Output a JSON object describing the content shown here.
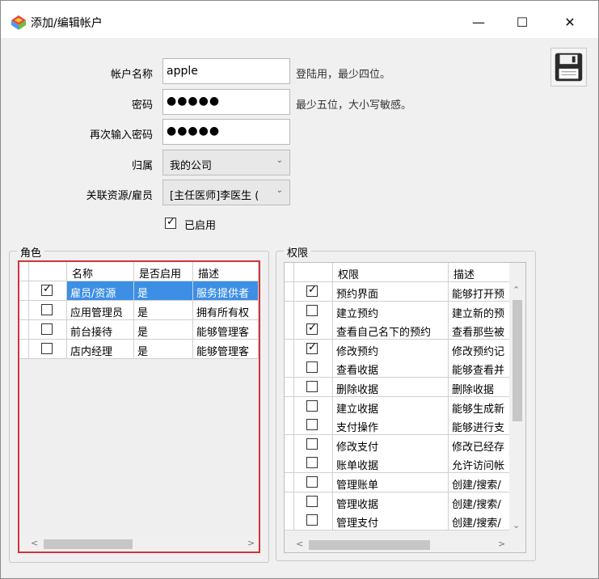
{
  "window": {
    "title": "添加/编辑帐户"
  },
  "caption": {
    "minimize": "—",
    "maximize": "☐",
    "close": "✕"
  },
  "form": {
    "account_name_label": "帐户名称",
    "account_name_value": "apple",
    "account_name_hint": "登陆用，最少四位。",
    "password_label": "密码",
    "password_value": "●●●●●",
    "password_hint": "最少五位，大小写敏感。",
    "password_confirm_label": "再次输入密码",
    "password_confirm_value": "●●●●●",
    "belongs_label": "归属",
    "belongs_value": "我的公司",
    "resource_label": "关联资源/雇员",
    "resource_value": "[主任医师]李医生 (",
    "enabled_label": "已启用",
    "enabled_checked": true
  },
  "roles": {
    "group_title": "角色",
    "headers": [
      "名称",
      "是否启用",
      "描述"
    ],
    "rows": [
      {
        "checked": true,
        "name": "雇员/资源",
        "enabled": "是",
        "desc": "服务提供者"
      },
      {
        "checked": false,
        "name": "应用管理员",
        "enabled": "是",
        "desc": "拥有所有权"
      },
      {
        "checked": false,
        "name": "前台接待",
        "enabled": "是",
        "desc": "能够管理客"
      },
      {
        "checked": false,
        "name": "店内经理",
        "enabled": "是",
        "desc": "能够管理客"
      }
    ]
  },
  "permissions": {
    "group_title": "权限",
    "headers": [
      "权限",
      "描述"
    ],
    "rows": [
      {
        "checked": true,
        "name": "预约界面",
        "desc": "能够打开预"
      },
      {
        "checked": false,
        "name": "建立预约",
        "desc": "建立新的预"
      },
      {
        "checked": true,
        "name": "查看自己名下的预约",
        "desc": "查看那些被"
      },
      {
        "checked": true,
        "name": "修改预约",
        "desc": "修改预约记"
      },
      {
        "checked": false,
        "name": "查看收据",
        "desc": "能够查看并"
      },
      {
        "checked": false,
        "name": "删除收据",
        "desc": "删除收据"
      },
      {
        "checked": false,
        "name": "建立收据",
        "desc": "能够生成新"
      },
      {
        "checked": false,
        "name": "支付操作",
        "desc": "能够进行支"
      },
      {
        "checked": false,
        "name": "修改支付",
        "desc": "修改已经存"
      },
      {
        "checked": false,
        "name": "账单收据",
        "desc": "允许访问帐"
      },
      {
        "checked": false,
        "name": "管理账单",
        "desc": "创建/搜索/"
      },
      {
        "checked": false,
        "name": "管理收据",
        "desc": "创建/搜索/"
      },
      {
        "checked": false,
        "name": "管理支付",
        "desc": "创建/搜索/"
      }
    ]
  },
  "colors": {
    "selection": "#3d8fe5",
    "highlight_border": "#d1343a"
  },
  "icons": {
    "save": "floppy-disk-icon",
    "app": "app-logo-icon"
  }
}
